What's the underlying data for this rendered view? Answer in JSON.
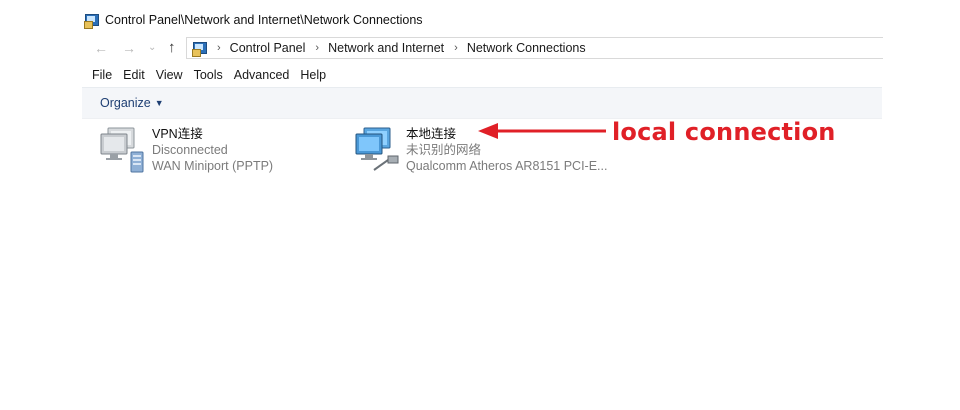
{
  "window": {
    "title": "Control Panel\\Network and Internet\\Network Connections"
  },
  "nav": {
    "breadcrumbs": [
      "Control Panel",
      "Network and Internet",
      "Network Connections"
    ]
  },
  "menu": {
    "items": [
      "File",
      "Edit",
      "View",
      "Tools",
      "Advanced",
      "Help"
    ]
  },
  "commandbar": {
    "organize_label": "Organize"
  },
  "connections": [
    {
      "name": "VPN连接",
      "status": "Disconnected",
      "device": "WAN Miniport (PPTP)",
      "icon": "vpn-connection-icon"
    },
    {
      "name": "本地连接",
      "status": "未识别的网络",
      "device": "Qualcomm Atheros AR8151 PCI-E...",
      "icon": "ethernet-connection-icon"
    }
  ],
  "annotation": {
    "text": "local connection",
    "color": "#e02027"
  }
}
